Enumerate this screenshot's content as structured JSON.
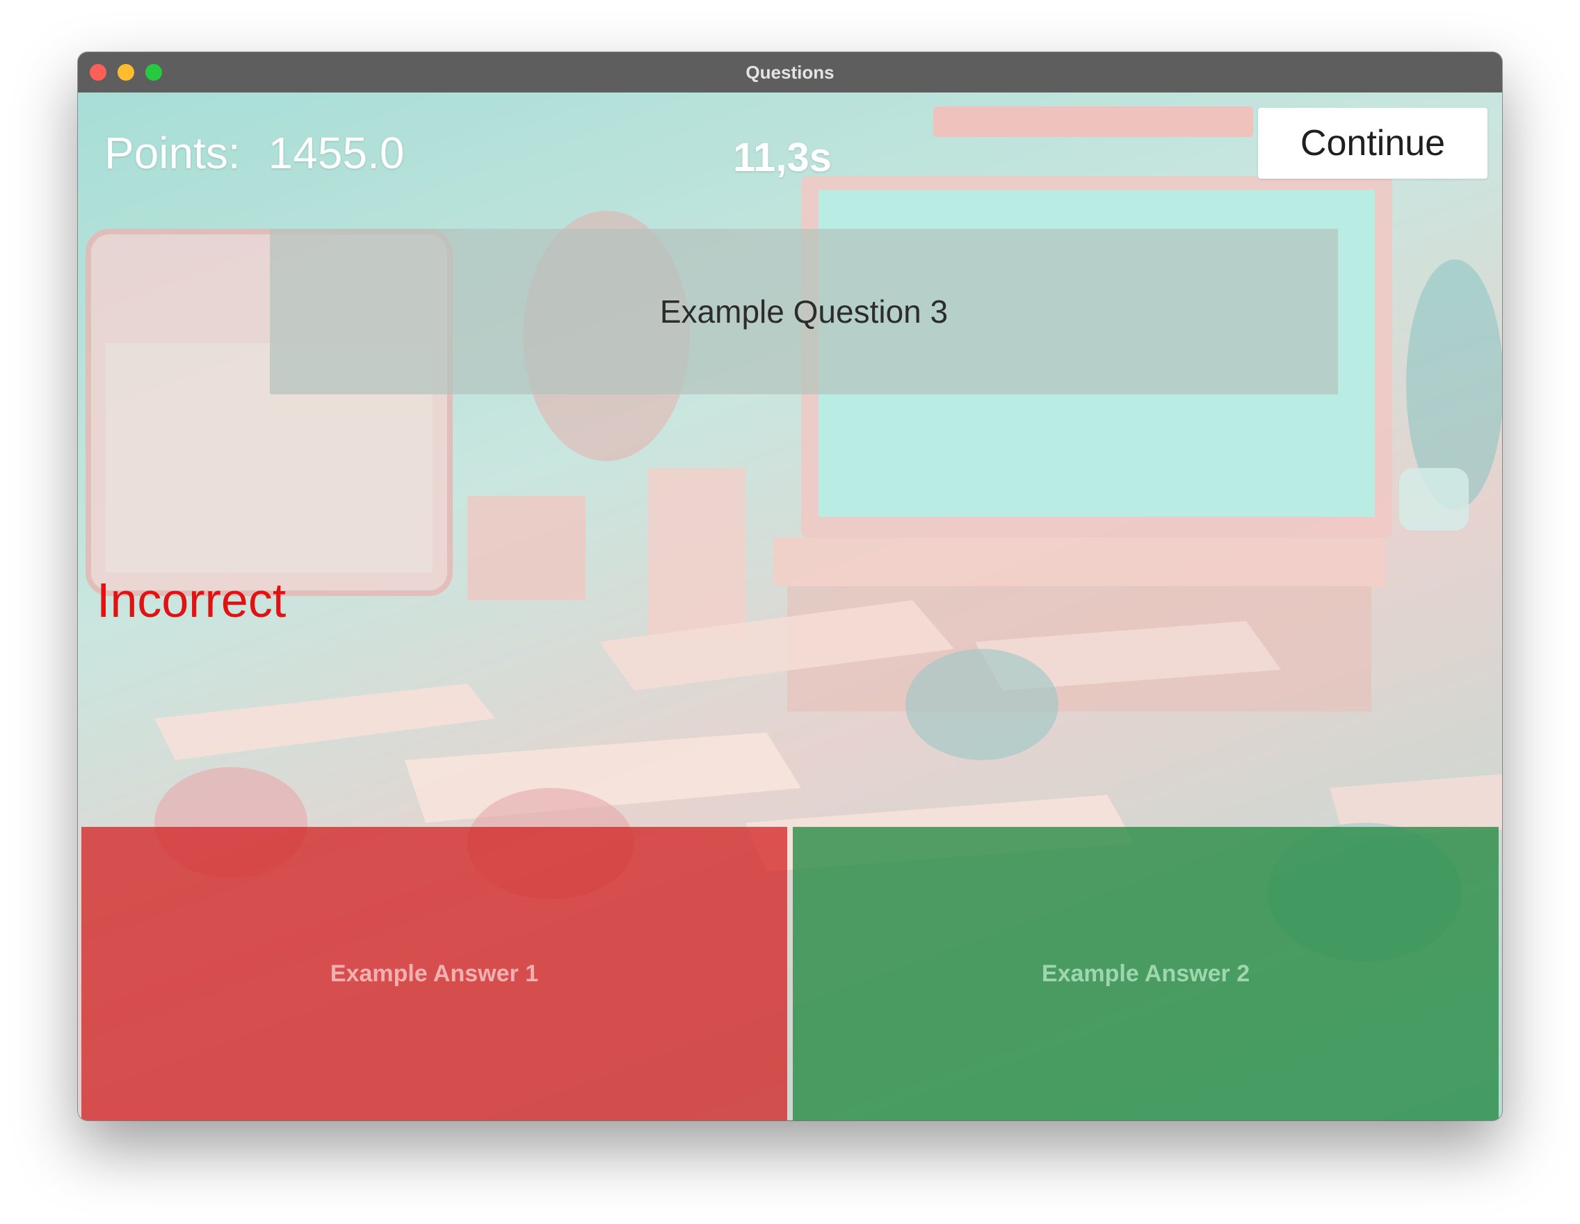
{
  "window": {
    "title": "Questions"
  },
  "header": {
    "points_label": "Points:",
    "points_value": "1455.0",
    "timer": "11,3s",
    "continue_label": "Continue"
  },
  "question": {
    "text": "Example Question 3"
  },
  "feedback": {
    "text": "Incorrect",
    "color": "#e01212"
  },
  "answers": [
    {
      "label": "Example Answer 1",
      "state": "incorrect",
      "color": "#d22828"
    },
    {
      "label": "Example Answer 2",
      "state": "correct",
      "color": "#288c46"
    }
  ]
}
